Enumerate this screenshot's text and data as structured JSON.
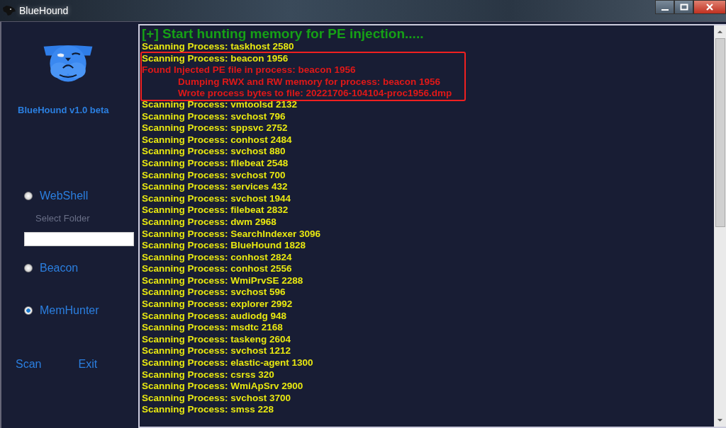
{
  "window": {
    "title": "BlueHound"
  },
  "sidebar": {
    "app_name": "BlueHound v1.0 beta",
    "modes": [
      {
        "label": "WebShell",
        "selected": false
      },
      {
        "label": "Beacon",
        "selected": false
      },
      {
        "label": "MemHunter",
        "selected": true
      }
    ],
    "folder": {
      "label": "Select Folder"
    },
    "actions": [
      "Scan",
      "Exit"
    ]
  },
  "log": {
    "header": "[+] Start hunting memory for PE injection.....",
    "blocks": [
      {
        "kind": "plain",
        "lines": [
          {
            "kind": "scan",
            "text": "Scanning Process: taskhost 2580"
          }
        ]
      },
      {
        "kind": "boxed",
        "lines": [
          {
            "kind": "scan",
            "text": "Scanning Process: beacon 1956"
          },
          {
            "kind": "found",
            "text": "Found Injected PE file in process: beacon 1956"
          },
          {
            "kind": "detail",
            "text": "Dumping RWX and RW memory for process: beacon 1956"
          },
          {
            "kind": "detail",
            "text": "Wrote process bytes to file: 20221706-104104-proc1956.dmp"
          }
        ]
      },
      {
        "kind": "plain",
        "lines": [
          {
            "kind": "scan",
            "text": "Scanning Process: vmtoolsd 2132"
          },
          {
            "kind": "scan",
            "text": "Scanning Process: svchost 796"
          },
          {
            "kind": "scan",
            "text": "Scanning Process: sppsvc 2752"
          },
          {
            "kind": "scan",
            "text": "Scanning Process: conhost 2484"
          },
          {
            "kind": "scan",
            "text": "Scanning Process: svchost 880"
          },
          {
            "kind": "scan",
            "text": "Scanning Process: filebeat 2548"
          },
          {
            "kind": "scan",
            "text": "Scanning Process: svchost 700"
          },
          {
            "kind": "scan",
            "text": "Scanning Process: services 432"
          },
          {
            "kind": "scan",
            "text": "Scanning Process: svchost 1944"
          },
          {
            "kind": "scan",
            "text": "Scanning Process: filebeat 2832"
          },
          {
            "kind": "scan",
            "text": "Scanning Process: dwm 2968"
          },
          {
            "kind": "scan",
            "text": "Scanning Process: SearchIndexer 3096"
          },
          {
            "kind": "scan",
            "text": "Scanning Process: BlueHound 1828"
          },
          {
            "kind": "scan",
            "text": "Scanning Process: conhost 2824"
          },
          {
            "kind": "scan",
            "text": "Scanning Process: conhost 2556"
          },
          {
            "kind": "scan",
            "text": "Scanning Process: WmiPrvSE 2288"
          },
          {
            "kind": "scan",
            "text": "Scanning Process: svchost 596"
          },
          {
            "kind": "scan",
            "text": "Scanning Process: explorer 2992"
          },
          {
            "kind": "scan",
            "text": "Scanning Process: audiodg 948"
          },
          {
            "kind": "scan",
            "text": "Scanning Process: msdtc 2168"
          },
          {
            "kind": "scan",
            "text": "Scanning Process: taskeng 2604"
          },
          {
            "kind": "scan",
            "text": "Scanning Process: svchost 1212"
          },
          {
            "kind": "scan",
            "text": "Scanning Process: elastic-agent 1300"
          },
          {
            "kind": "scan",
            "text": "Scanning Process: csrss 320"
          },
          {
            "kind": "scan",
            "text": "Scanning Process: WmiApSrv 2900"
          },
          {
            "kind": "scan",
            "text": "Scanning Process: svchost 3700"
          },
          {
            "kind": "scan",
            "text": "Scanning Process: smss 228"
          }
        ]
      }
    ]
  }
}
